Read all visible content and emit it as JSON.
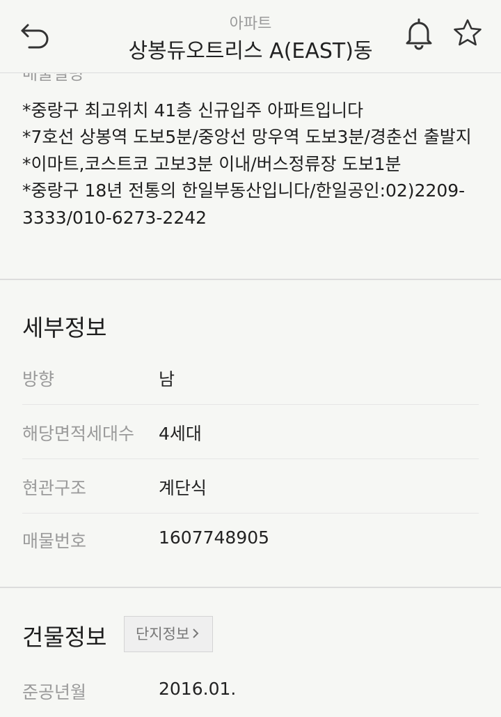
{
  "header": {
    "subtitle": "아파트",
    "title": "상봉듀오트리스 A(EAST)동",
    "icons": [
      "back-arrow-icon",
      "bell-icon",
      "star-icon"
    ]
  },
  "description": {
    "heading": "매물설명",
    "lines": [
      "*중랑구 최고위치 41층 신규입주 아파트입니다",
      "*7호선 상봉역 도보5분/중앙선 망우역 도보3분/경춘선 출발지",
      "*이마트,코스트코 고보3분 이내/버스정류장 도보1분",
      "*중랑구 18년 전통의 한일부동산입니다/한일공인:02)2209-3333/010-6273-2242"
    ]
  },
  "details": {
    "title": "세부정보",
    "rows": [
      {
        "label": "방향",
        "value": "남"
      },
      {
        "label": "해당면적세대수",
        "value": "4세대"
      },
      {
        "label": "현관구조",
        "value": "계단식"
      },
      {
        "label": "매물번호",
        "value": "1607748905"
      }
    ]
  },
  "building": {
    "title": "건물정보",
    "complex_button": "단지정보",
    "rows": [
      {
        "label": "준공년월",
        "value": "2016.01."
      }
    ]
  }
}
